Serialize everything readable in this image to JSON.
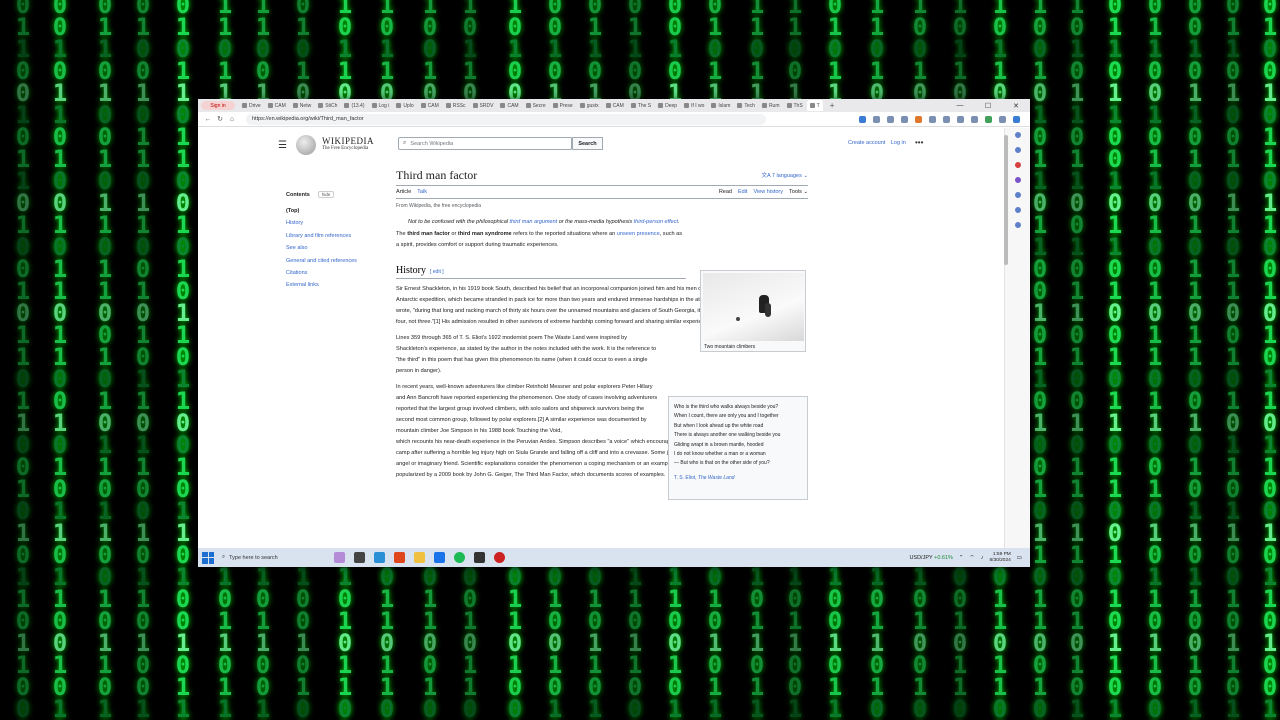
{
  "browser": {
    "profile_label": "Sign in",
    "tabs": [
      "Drive",
      "CAM",
      "Netw",
      "StiCh",
      "(13.4)",
      "Log i",
      "Uplo",
      "CAM",
      "RSSc",
      "SRDV",
      "CAM",
      "Secre",
      "Prese",
      "gustx",
      "CAM",
      "The S",
      "Deep",
      "If I wo",
      "Islam",
      "Tech",
      "Rum",
      "ThS",
      "T"
    ],
    "active_tab": "T",
    "url": "https://en.wikipedia.org/wiki/Third_man_factor"
  },
  "wiki": {
    "wordmark": "WIKIPEDIA",
    "tagline": "The Free Encyclopedia",
    "search_placeholder": "Search Wikipedia",
    "search_button": "Search",
    "create_account": "Create account",
    "log_in": "Log in",
    "more": "•••"
  },
  "toc": {
    "title": "Contents",
    "hide": "hide",
    "items": [
      "(Top)",
      "History",
      "Library and film references",
      "See also",
      "General and cited references",
      "Citations",
      "External links"
    ]
  },
  "article": {
    "title": "Third man factor",
    "languages": "7 languages",
    "tab_article": "Article",
    "tab_talk": "Talk",
    "tab_read": "Read",
    "tab_edit": "Edit",
    "tab_history": "View history",
    "tab_tools": "Tools",
    "from": "From Wikipedia, the free encyclopedia",
    "hatnote_pre": "Not to be confused with the philosophical ",
    "hatnote_link1": "third man argument",
    "hatnote_mid": " or the mass-media hypothesis ",
    "hatnote_link2": "third-person effect",
    "hatnote_end": ".",
    "intro_b1": "third man factor",
    "intro_b2": "third man syndrome",
    "intro_pre": "The ",
    "intro_or": " or ",
    "intro_mid": " refers to the reported situations where an ",
    "intro_link": "unseen presence",
    "intro_end": ", such as a spirit, provides comfort or support during traumatic experiences.",
    "history_heading": "History",
    "edit_label": "[ edit ]",
    "p1": "Sir Ernest Shackleton, in his 1919 book South, described his belief that an incorporeal companion joined him and his men during the final leg of his 1914–1917 Antarctic expedition, which became stranded in pack ice for more than two years and endured immense hardships in the attempt to reach safety. Shackleton wrote, \"during that long and racking march of thirty six hours over the unnamed mountains and glaciers of South Georgia, it seemed to me often that we were four, not three.\"[1] His admission resulted in other survivors of extreme hardship coming forward and sharing similar experiences.",
    "p2": "Lines 359 through 365 of T. S. Eliot's 1922 modernist poem The Waste Land were inspired by Shackleton's experience, as stated by the author in the notes included with the work. It is the reference to \"the third\" in this poem that has given this phenomenon its name (when it could occur to even a single person in danger).",
    "p3": "In recent years, well-known adventurers like climber Reinhold Messner and polar explorers Peter Hillary and Ann Bancroft have reported experiencing the phenomenon. One study of cases involving adventurers reported that the largest group involved climbers, with solo sailors and shipwreck survivors being the second most common group, followed by polar explorers.[2] A similar experience was documented by mountain climber Joe Simpson in his 1988 book Touching the Void,",
    "p4": "which recounts his near-death experience in the Peruvian Andes. Simpson describes \"a voice\" which encouraged him and directed him as he crawled back to base camp after suffering a horrible leg injury high on Siula Grande and falling off a cliff and into a crevasse. Some journalists have related this to the concept of a guardian angel or imaginary friend. Scientific explanations consider the phenomenon a coping mechanism or an example of bicameral mentality.[3] The concept was popularized by a 2009 book by John G. Geiger, The Third Man Factor, which documents scores of examples.",
    "thumb_caption": "Two mountain climbers",
    "poem_lines": [
      "Who is the third who walks always beside you?",
      "When I count, there are only you and I together",
      "But when I look ahead up the white road",
      "There is always another one walking beside you",
      "Gliding wrapt in a brown mantle, hooded",
      "I do not know whether a man or a woman",
      "— But who is that on the other side of you?"
    ],
    "poem_attr_author": "T. S. Eliot, ",
    "poem_attr_work": "The Waste Land"
  },
  "taskbar": {
    "search_placeholder": "Type here to search",
    "ticker_symbol": "USD/JPY",
    "ticker_change": "+0.61%",
    "time": "1:59 PM",
    "date": "8/30/2024"
  },
  "colors": {
    "matrix": "#1ee85a",
    "link": "#3366cc",
    "text": "#202122"
  }
}
